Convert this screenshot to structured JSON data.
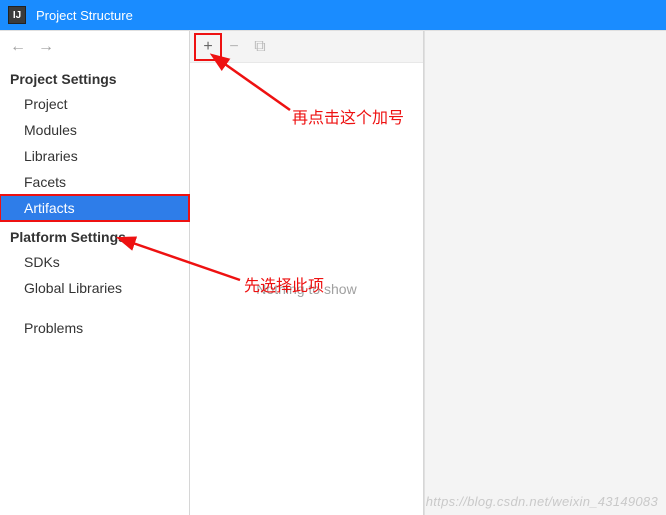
{
  "window": {
    "title": "Project Structure"
  },
  "sidebar": {
    "sections": [
      {
        "header": "Project Settings",
        "items": [
          {
            "label": "Project",
            "selected": false
          },
          {
            "label": "Modules",
            "selected": false
          },
          {
            "label": "Libraries",
            "selected": false
          },
          {
            "label": "Facets",
            "selected": false
          },
          {
            "label": "Artifacts",
            "selected": true,
            "highlighted": true
          }
        ]
      },
      {
        "header": "Platform Settings",
        "items": [
          {
            "label": "SDKs",
            "selected": false
          },
          {
            "label": "Global Libraries",
            "selected": false
          }
        ]
      }
    ],
    "problems_label": "Problems"
  },
  "toolbar": {
    "add_tooltip": "+",
    "remove_tooltip": "−",
    "copy_tooltip": "⧉"
  },
  "mid_panel": {
    "empty_text": "Nothing to show"
  },
  "annotations": {
    "note_add": "再点击这个加号",
    "note_select": "先选择此项"
  },
  "watermark": "https://blog.csdn.net/weixin_43149083"
}
